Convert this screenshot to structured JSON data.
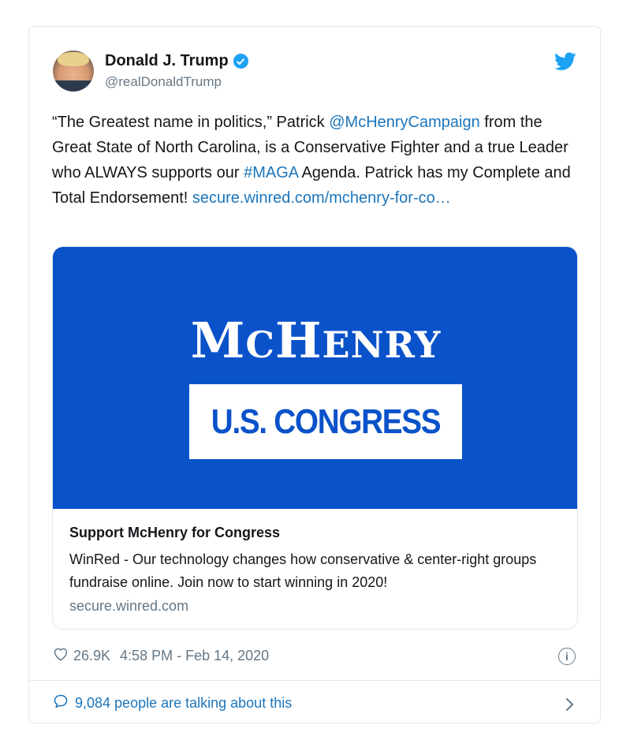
{
  "author": {
    "display_name": "Donald J. Trump",
    "handle": "@realDonaldTrump",
    "verified": true
  },
  "tweet": {
    "segments": [
      {
        "text": "“The Greatest name in politics,” Patrick ",
        "type": "text"
      },
      {
        "text": "@McHenryCampaign",
        "type": "mention"
      },
      {
        "text": " from the Great State of North Carolina, is a Conservative Fighter and a true Leader who ALWAYS supports our ",
        "type": "text"
      },
      {
        "text": "#MAGA",
        "type": "hashtag"
      },
      {
        "text": " Agenda. Patrick has my Complete and Total Endorsement! ",
        "type": "text"
      },
      {
        "text": "secure.winred.com/mchenry-for-co…",
        "type": "url"
      }
    ]
  },
  "media_card": {
    "banner_logo_big_1": "M",
    "banner_logo_small_1": "C",
    "banner_logo_big_2": "H",
    "banner_logo_small_2": "ENRY",
    "banner_congress": "U.S. CONGRESS",
    "banner_color": "#0a52c9",
    "title": "Support McHenry for Congress",
    "description": "WinRed - Our technology changes how conservative & center-right groups fundraise online. Join now to start winning in 2020!",
    "domain": "secure.winred.com"
  },
  "meta": {
    "like_count": "26.9K",
    "timestamp": "4:58 PM - Feb 14, 2020"
  },
  "footer": {
    "talking_text": "9,084 people are talking about this"
  },
  "colors": {
    "link": "#1b75bb",
    "twitter_blue": "#1da1f2",
    "muted": "#657786"
  },
  "icons": [
    "verified-badge-icon",
    "twitter-bird-icon",
    "heart-icon",
    "info-icon",
    "comment-bubble-icon",
    "chevron-right-icon"
  ]
}
